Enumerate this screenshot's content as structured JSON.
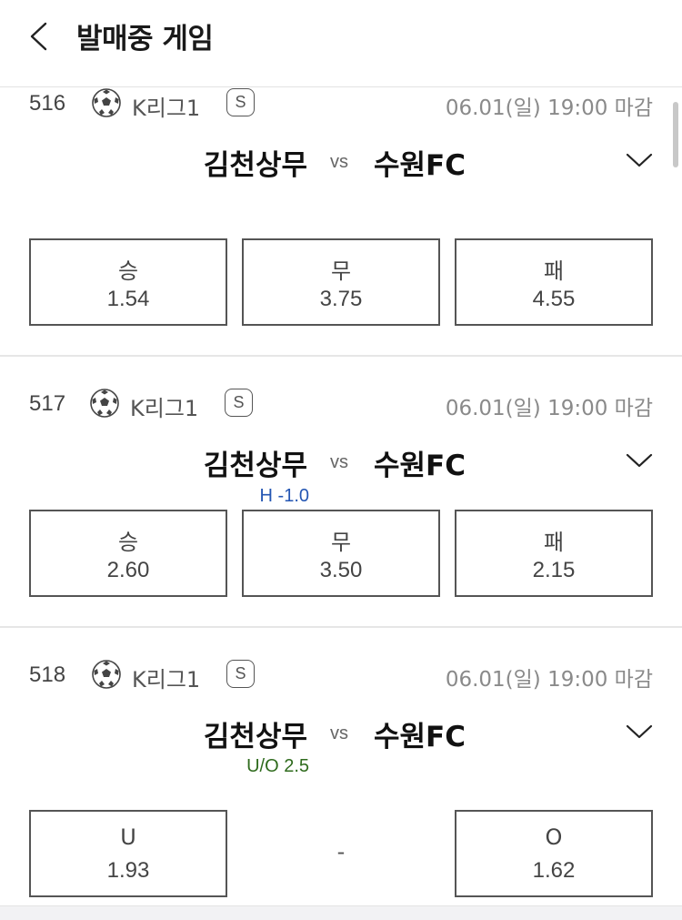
{
  "header": {
    "title": "발매중 게임"
  },
  "games": [
    {
      "number": "516",
      "league": "K리그1",
      "badge": "S",
      "deadline": "06.01(일) 19:00 마감",
      "home": "김천상무",
      "vs": "vs",
      "away": "수원FC",
      "handicap": "",
      "odds": [
        {
          "label": "승",
          "value": "1.54"
        },
        {
          "label": "무",
          "value": "3.75"
        },
        {
          "label": "패",
          "value": "4.55"
        }
      ]
    },
    {
      "number": "517",
      "league": "K리그1",
      "badge": "S",
      "deadline": "06.01(일) 19:00 마감",
      "home": "김천상무",
      "vs": "vs",
      "away": "수원FC",
      "handicap": "H -1.0",
      "odds": [
        {
          "label": "승",
          "value": "2.60"
        },
        {
          "label": "무",
          "value": "3.50"
        },
        {
          "label": "패",
          "value": "2.15"
        }
      ]
    },
    {
      "number": "518",
      "league": "K리그1",
      "badge": "S",
      "deadline": "06.01(일) 19:00 마감",
      "home": "김천상무",
      "vs": "vs",
      "away": "수원FC",
      "handicap": "U/O 2.5",
      "odds": [
        {
          "label": "U",
          "value": "1.93"
        },
        {
          "label": "",
          "value": "-"
        },
        {
          "label": "O",
          "value": "1.62"
        }
      ]
    }
  ],
  "icons": {
    "back": "chevron-left-icon",
    "expand": "chevron-down-icon",
    "sport": "soccer-ball-icon"
  },
  "colors": {
    "handicap_h": "#2456b3",
    "handicap_uo": "#2f6b1d",
    "border": "#555555"
  }
}
